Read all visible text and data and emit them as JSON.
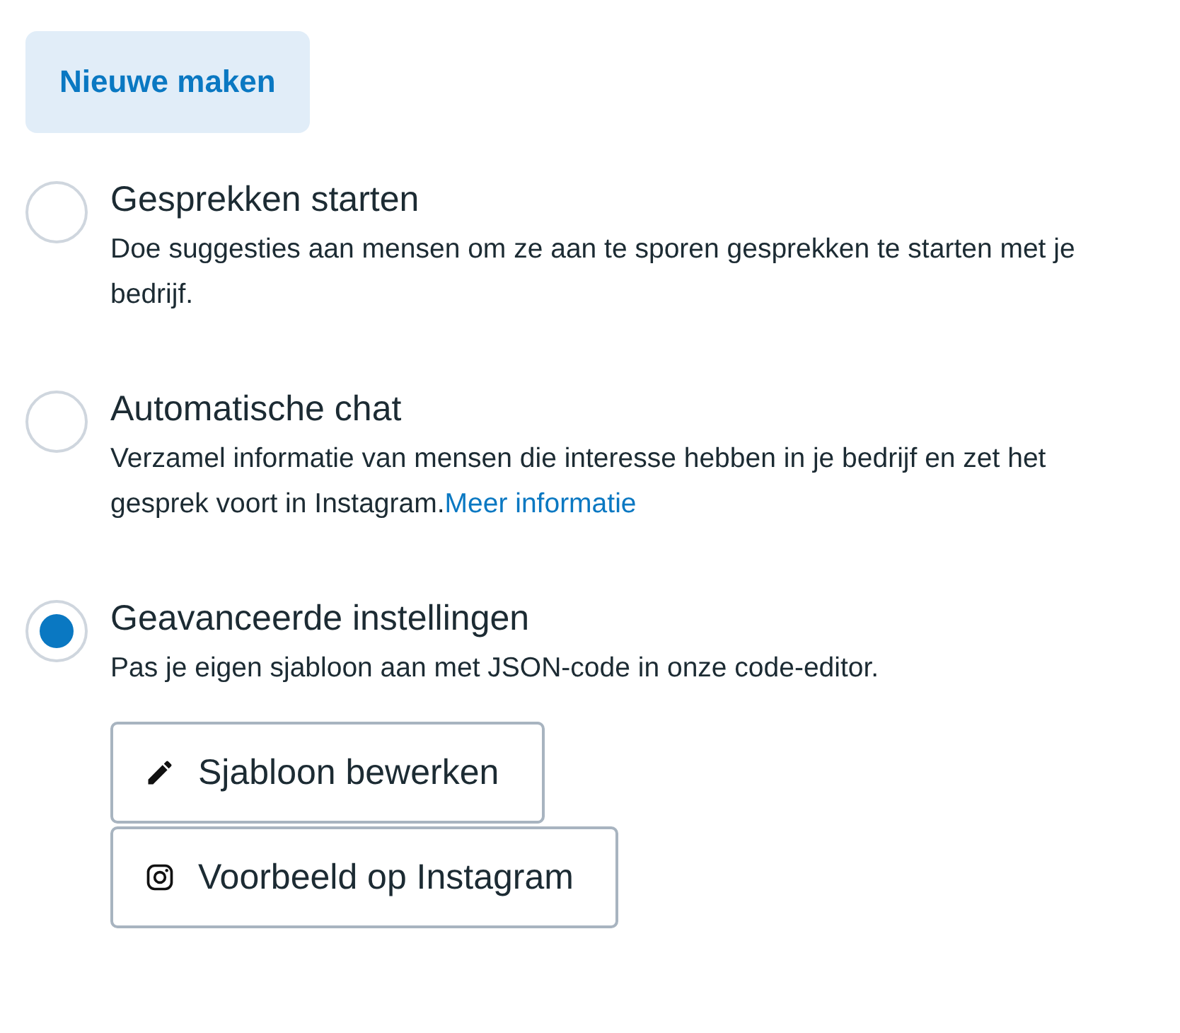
{
  "create_button": {
    "label": "Nieuwe maken"
  },
  "options": [
    {
      "title": "Gesprekken starten",
      "description": "Doe suggesties aan mensen om ze aan te sporen gesprekken te starten met je bedrijf.",
      "selected": false
    },
    {
      "title": "Automatische chat",
      "description": "Verzamel informatie van mensen die interesse hebben in je bedrijf en zet het gesprek voort in Instagram.",
      "link": "Meer informatie",
      "selected": false
    },
    {
      "title": "Geavanceerde instellingen",
      "description": "Pas je eigen sjabloon aan met JSON-code in onze code-editor.",
      "selected": true,
      "buttons": [
        {
          "kind": "edit",
          "label": "Sjabloon bewerken"
        },
        {
          "kind": "instagram",
          "label": "Voorbeeld op Instagram"
        }
      ]
    }
  ]
}
